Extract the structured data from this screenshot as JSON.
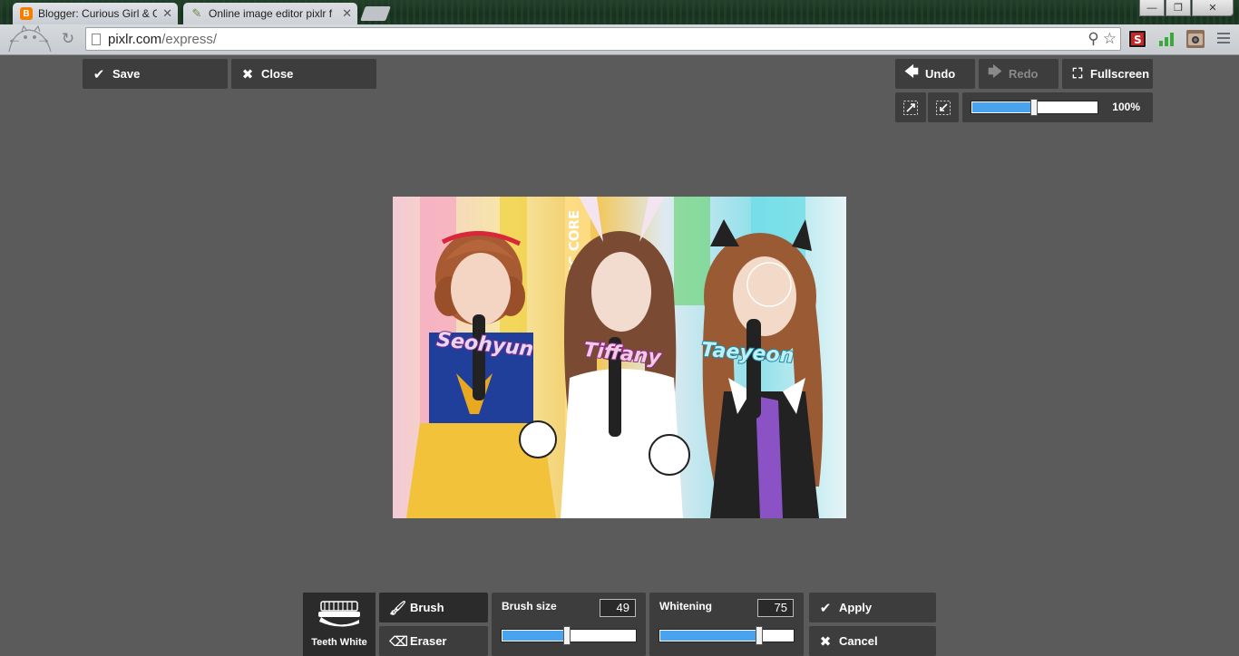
{
  "browser": {
    "tabs": [
      {
        "title": "Blogger: Curious Girl & Gi",
        "icon": "blogger-icon",
        "active": false
      },
      {
        "title": "Online image editor pixlr f",
        "icon": "pixlr-brush-icon",
        "active": true
      }
    ],
    "url": {
      "host": "pixlr.com",
      "path": "/express/"
    },
    "window_controls": {
      "minimize": "—",
      "maximize": "❐",
      "close": "✕"
    }
  },
  "top_left": {
    "save_label": "Save",
    "close_label": "Close"
  },
  "top_right": {
    "undo_label": "Undo",
    "redo_label": "Redo",
    "fullscreen_label": "Fullscreen",
    "zoom": {
      "value_text": "100%",
      "slider_fraction": 0.5
    }
  },
  "photo": {
    "captions": [
      "Seohyun",
      "Tiffany",
      "Taeyeon"
    ],
    "background_text": [
      "MUSIC CORE"
    ]
  },
  "tool_panel": {
    "tool_label": "Teeth White",
    "brush_label": "Brush",
    "eraser_label": "Eraser",
    "brush_size": {
      "label": "Brush size",
      "value": "49",
      "fraction": 0.49
    },
    "whitening": {
      "label": "Whitening",
      "value": "75",
      "fraction": 0.75
    },
    "apply_label": "Apply",
    "cancel_label": "Cancel"
  },
  "colors": {
    "background": "#5b5b5b",
    "button": "#3d3d3d",
    "slider_fill": "#4aa3ee",
    "blogger_orange": "#f57d00"
  }
}
